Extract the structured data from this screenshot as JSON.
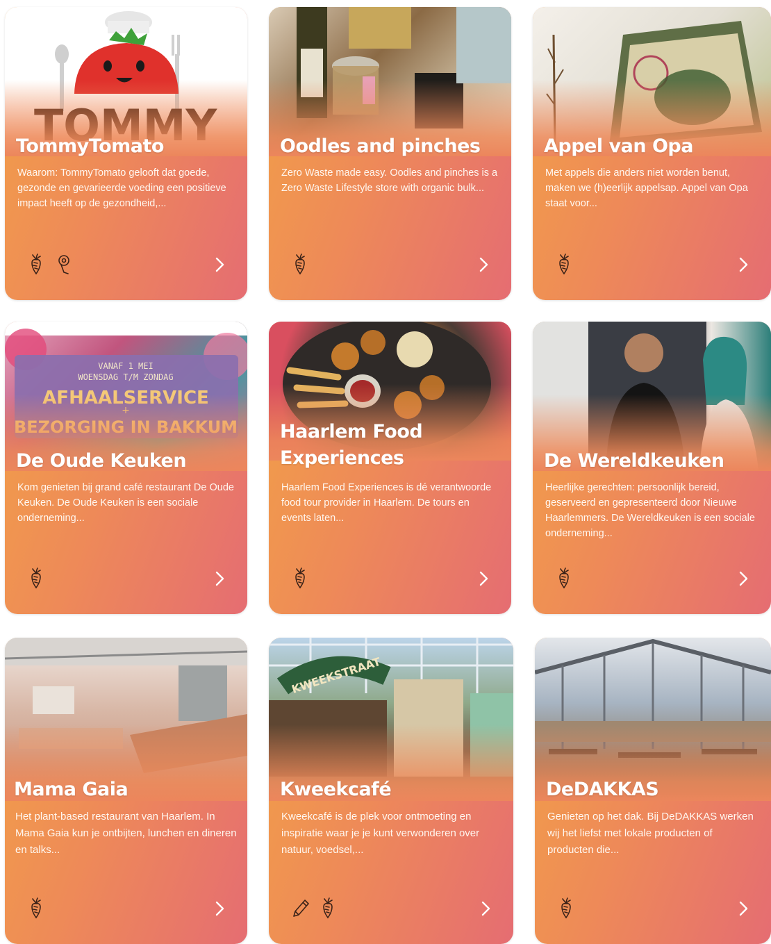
{
  "cards": [
    {
      "title": "TommyTomato",
      "desc": "Waarom: TommyTomato gelooft dat goede, gezonde en gevarieerde voeding een positieve impact heeft op de gezondheid,...",
      "icons": [
        "carrot-icon",
        "location-pin-icon"
      ],
      "logo_text": "TOMMY"
    },
    {
      "title": "Oodles and pinches",
      "desc": "Zero Waste made easy. Oodles and pinches is a Zero Waste Lifestyle store with organic bulk...",
      "icons": [
        "carrot-icon"
      ]
    },
    {
      "title": "Appel van Opa",
      "desc": "Met appels die anders niet worden benut, maken we (h)eerlijk appelsap. Appel van Opa staat voor...",
      "icons": [
        "carrot-icon"
      ]
    },
    {
      "title": "De Oude Keuken",
      "desc": "Kom genieten bij grand café restaurant De Oude Keuken. De Oude Keuken is een sociale onderneming...",
      "icons": [
        "carrot-icon"
      ],
      "poster": {
        "line1": "VANAF 1 MEI",
        "line2": "WOENSDAG T/M ZONDAG",
        "line3": "AFHAALSERVICE",
        "line4": "+",
        "line5": "BEZORGING IN BAKKUM"
      }
    },
    {
      "title": "Haarlem Food Experiences",
      "desc": "Haarlem Food Experiences is dé verantwoorde food tour provider in Haarlem. De tours en events laten...",
      "icons": [
        "carrot-icon"
      ]
    },
    {
      "title": "De Wereldkeuken",
      "desc": "Heerlijke gerechten: persoonlijk bereid, geserveerd en gepresenteerd door Nieuwe Haarlemmers. De Wereldkeuken is een sociale onderneming...",
      "icons": [
        "carrot-icon"
      ]
    },
    {
      "title": "Mama Gaia",
      "desc": "Het plant-based restaurant van Haarlem. In Mama Gaia kun je ontbijten, lunchen en dineren en talks...",
      "icons": [
        "carrot-icon"
      ]
    },
    {
      "title": "Kweekcafé",
      "desc": "Kweekcafé is de plek voor ontmoeting en inspiratie waar je je kunt verwonderen over natuur, voedsel,...",
      "icons": [
        "pencil-icon",
        "carrot-icon"
      ],
      "sign_text": "KWEEKSTRAAT"
    },
    {
      "title": "DeDAKKAS",
      "desc": "Genieten op het dak. Bij DeDAKKAS werken wij het liefst met lokale producten of producten die...",
      "icons": [
        "carrot-icon"
      ]
    }
  ],
  "colors": {
    "gradient_start": "#f2a048",
    "gradient_end": "#e56d72",
    "text": "#ffffff"
  }
}
